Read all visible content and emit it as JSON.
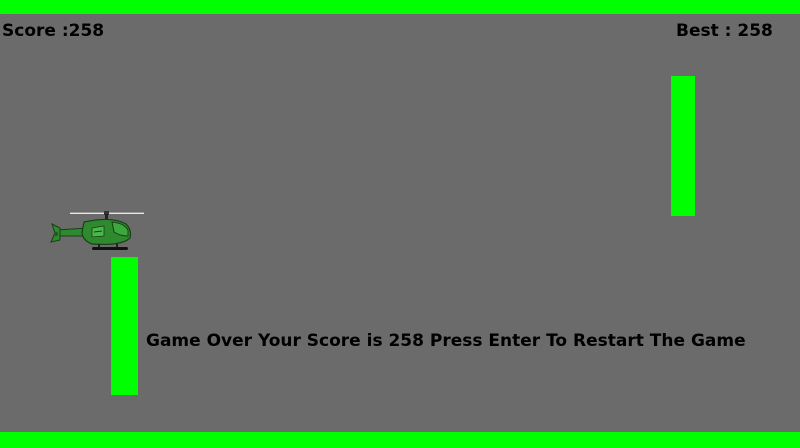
{
  "hud": {
    "score_text": "Score :258",
    "best_text": "Best : 258",
    "score": 258,
    "best": 258
  },
  "message": {
    "game_over_text": "Game Over Your Score is 258 Press Enter To Restart The Game"
  },
  "colors": {
    "background": "#6b6b6b",
    "border": "#00ff00",
    "pipe": "#00ff00",
    "text": "#000000",
    "helicopter_body": "#2f8a2f"
  },
  "sprites": {
    "player": "helicopter-icon"
  }
}
